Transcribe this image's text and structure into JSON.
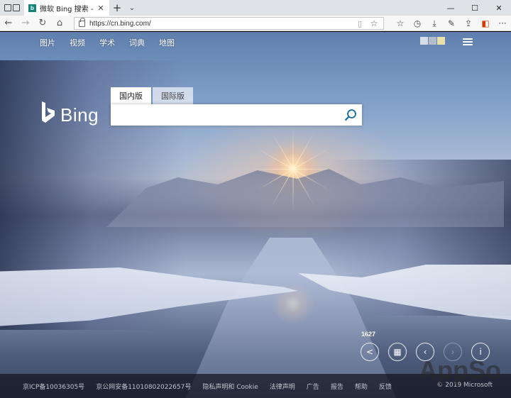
{
  "browser": {
    "tab": {
      "title": "微软 Bing 搜索 - 国内版",
      "favicon": "bing-favicon"
    },
    "new_tab_label": "+",
    "tab_menu_label": "⌄",
    "window_controls": {
      "minimize": "—",
      "maximize": "☐",
      "close": "✕"
    },
    "address": {
      "url": "https://cn.bing.com/"
    },
    "nav_icons": [
      "back-arrow-icon",
      "forward-arrow-icon",
      "refresh-icon",
      "home-icon"
    ],
    "toolbar_icons": [
      "favorites-icon",
      "history-icon",
      "downloads-icon",
      "pen-icon",
      "share-icon",
      "office-icon",
      "more-icon"
    ]
  },
  "page": {
    "topnav": [
      "图片",
      "视频",
      "学术",
      "词典",
      "地图"
    ],
    "logo_text": "Bing",
    "search": {
      "tabs": [
        "国内版",
        "国际版"
      ],
      "active_tab": "国内版",
      "value": "",
      "placeholder": ""
    },
    "image_count": "1627",
    "footer": {
      "links": [
        "京ICP备10036305号",
        "京公网安备11010802022657号",
        "隐私声明和 Cookie",
        "法律声明",
        "广告",
        "报告",
        "帮助",
        "反馈"
      ],
      "copyright": "© 2019 Microsoft"
    },
    "watermark": "AppSo",
    "colors": {
      "favicon": "#138476",
      "office": "#d83b01",
      "footer_bg": "#14141e"
    }
  }
}
